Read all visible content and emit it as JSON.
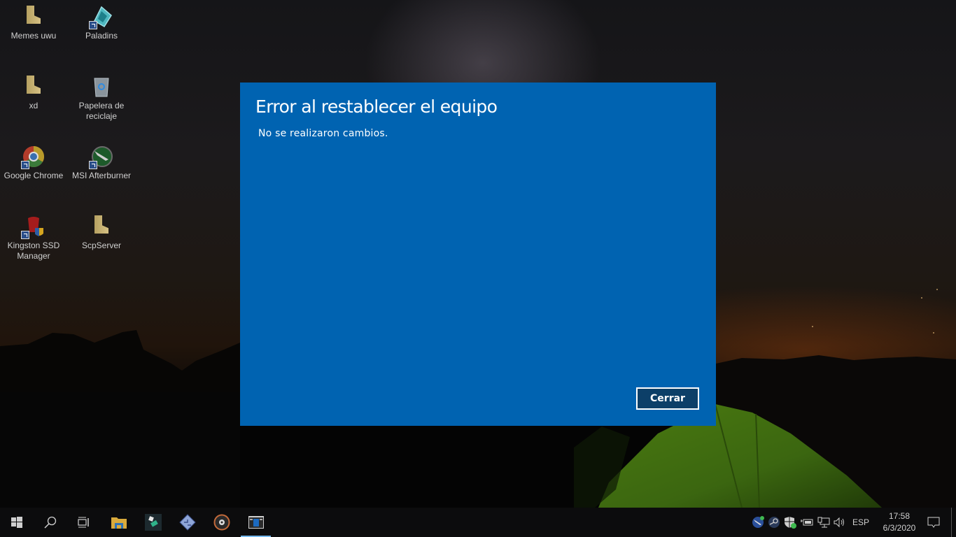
{
  "desktop": {
    "icons": [
      {
        "label": "Memes uwu",
        "icon": "folder-icon"
      },
      {
        "label": "Paladins",
        "icon": "paladins-icon",
        "shortcut": true
      },
      {
        "label": "xd",
        "icon": "folder-icon"
      },
      {
        "label": "Papelera de reciclaje",
        "icon": "recycle-bin-icon"
      },
      {
        "label": "Google Chrome",
        "icon": "chrome-icon",
        "shortcut": true
      },
      {
        "label": "MSI Afterburner",
        "icon": "msi-afterburner-icon",
        "shortcut": true
      },
      {
        "label": "Kingston SSD Manager",
        "icon": "kingston-icon",
        "shortcut": true
      },
      {
        "label": "ScpServer",
        "icon": "folder-icon"
      }
    ]
  },
  "dialog": {
    "title": "Error al restablecer el equipo",
    "message": "No se realizaron cambios.",
    "close_label": "Cerrar",
    "background": "#0063b1",
    "button_background": "#0c3f68"
  },
  "taskbar": {
    "buttons": [
      {
        "name": "start",
        "icon": "windows-logo-icon"
      },
      {
        "name": "search",
        "icon": "search-icon"
      },
      {
        "name": "task-view",
        "icon": "task-view-icon"
      },
      {
        "name": "file-explorer",
        "icon": "file-explorer-icon"
      },
      {
        "name": "filmora",
        "icon": "filmora-icon"
      },
      {
        "name": "pcsx2",
        "icon": "pcsx2-icon"
      },
      {
        "name": "groove-music",
        "icon": "music-disc-icon"
      },
      {
        "name": "reset-pc-window",
        "icon": "window-app-icon",
        "active": true
      }
    ],
    "tray": {
      "language": "ESP",
      "time": "17:58",
      "date": "6/3/2020",
      "icons": [
        "msi-afterburner-tray-icon",
        "steam-icon",
        "windows-security-icon",
        "battery-icon",
        "network-icon",
        "volume-icon"
      ]
    },
    "accent": "#76b9ed"
  }
}
